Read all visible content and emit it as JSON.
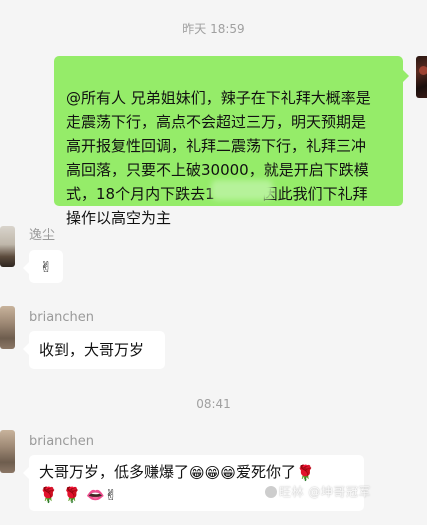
{
  "timestamps": [
    "昨天 18:59",
    "08:41"
  ],
  "messages": [
    {
      "sender": "",
      "side": "right",
      "text": "@所有人 兄弟姐妹们，辣子在下礼拜大概率是\n走震荡下行，高点不会超过三万，明天预期是\n高开报复性回调，礼拜二震荡下行，礼拜三冲\n高回落，只要不上破30000，就是开启下跌模\n式，18个月内下跌去1",
      "text_tail": "因此我们下礼拜",
      "text_end": "操作以高空为主"
    },
    {
      "sender": "逸尘",
      "side": "left",
      "text": "✌"
    },
    {
      "sender": "brianchen",
      "side": "left",
      "text": "收到，大哥万岁"
    },
    {
      "sender": "brianchen",
      "side": "left",
      "text": "大哥万岁，低多赚爆了",
      "text_after": "爱死你了",
      "emojis_line1": [
        "😁",
        "😁",
        "😁",
        "🌹"
      ],
      "emojis_line2": [
        "🌹",
        "🌹",
        "👄",
        "✌"
      ]
    }
  ],
  "watermark": "旺林 @坤哥冠军",
  "colors": {
    "bubble_self": "#95ec69",
    "bubble_other": "#ffffff",
    "background": "#f5f5f5"
  },
  "icons": [
    "avatar-self",
    "avatar-yichen",
    "avatar-brianchen"
  ]
}
